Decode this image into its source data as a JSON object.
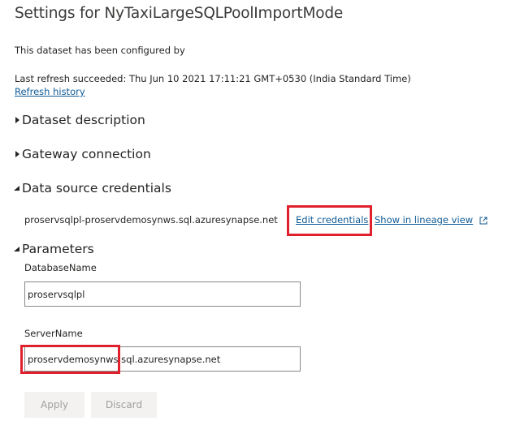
{
  "page": {
    "title": "Settings for NyTaxiLargeSQLPoolImportMode",
    "configured_by": "This dataset has been configured by",
    "last_refresh": "Last refresh succeeded: Thu Jun 10 2021 17:11:21 GMT+0530 (India Standard Time)",
    "refresh_history_link": "Refresh history"
  },
  "sections": {
    "dataset_description": {
      "label": "Dataset description",
      "expanded": false
    },
    "gateway_connection": {
      "label": "Gateway connection",
      "expanded": false
    },
    "data_source_credentials": {
      "label": "Data source credentials",
      "expanded": true
    },
    "parameters": {
      "label": "Parameters",
      "expanded": true
    }
  },
  "credentials": {
    "source_name": "proservsqlpl-proservdemosynws.sql.azuresynapse.net",
    "edit_link": "Edit credentials",
    "lineage_link": "Show in lineage view",
    "lineage_icon": "external-link-icon"
  },
  "parameters": {
    "database_name": {
      "label": "DatabaseName",
      "value": "proservsqlpl"
    },
    "server_name": {
      "label": "ServerName",
      "value": "proservdemosynws.sql.azuresynapse.net"
    }
  },
  "buttons": {
    "apply": "Apply",
    "discard": "Discard"
  },
  "colors": {
    "link": "#0f5b96",
    "highlight": "#e0202c",
    "disabled_button_bg": "#f3f2f1",
    "disabled_button_text": "#a19f9d"
  }
}
